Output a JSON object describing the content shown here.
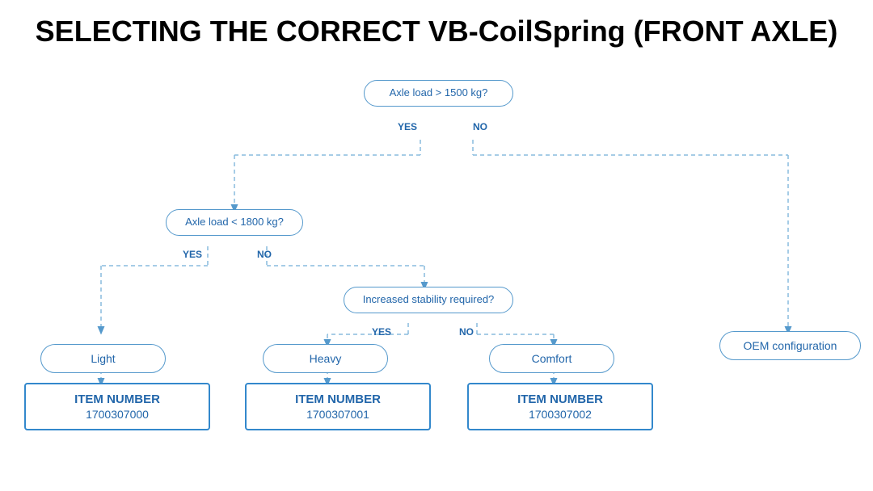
{
  "title": "SELECTING THE CORRECT VB-CoilSpring (FRONT AXLE)",
  "nodes": {
    "q1": {
      "text": "Axle load > 1500 kg?",
      "yes": "YES",
      "no": "NO"
    },
    "q2": {
      "text": "Axle load < 1800 kg?",
      "yes": "YES",
      "no": "NO"
    },
    "q3": {
      "text": "Increased stability required?",
      "yes": "YES",
      "no": "NO"
    },
    "r_light": {
      "text": "Light"
    },
    "r_heavy": {
      "text": "Heavy"
    },
    "r_comfort": {
      "text": "Comfort"
    },
    "r_oem": {
      "text": "OEM configuration"
    }
  },
  "items": {
    "item0": {
      "label": "ITEM NUMBER",
      "number": "1700307000"
    },
    "item1": {
      "label": "ITEM NUMBER",
      "number": "1700307001"
    },
    "item2": {
      "label": "ITEM NUMBER",
      "number": "1700307002"
    }
  },
  "colors": {
    "blue": "#2266aa",
    "border": "#5599cc",
    "line": "#88bbdd"
  }
}
